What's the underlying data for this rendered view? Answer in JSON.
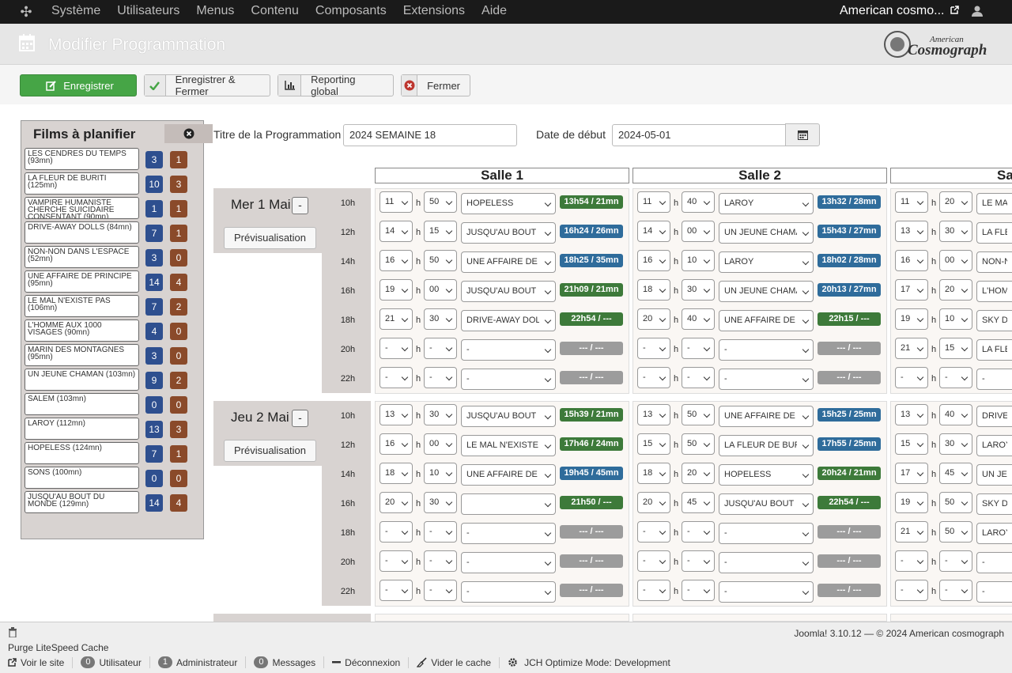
{
  "topnav": {
    "menu": [
      "Système",
      "Utilisateurs",
      "Menus",
      "Contenu",
      "Composants",
      "Extensions",
      "Aide"
    ],
    "site_name": "American cosmo..."
  },
  "header": {
    "title": "Modifier Programmation",
    "brand": "American Cosmograph"
  },
  "toolbar": {
    "save": "Enregistrer",
    "save_close": "Enregistrer & Fermer",
    "reporting": "Reporting global",
    "close": "Fermer"
  },
  "films_panel": {
    "title": "Films à planifier",
    "films": [
      {
        "name": "LES CENDRES DU TEMPS (93mn)",
        "n1": "3",
        "n2": "1"
      },
      {
        "name": "LA FLEUR DE BURITI (125mn)",
        "n1": "10",
        "n2": "3"
      },
      {
        "name": "VAMPIRE HUMANISTE CHERCHE SUICIDAIRE CONSENTANT (90mn)",
        "n1": "1",
        "n2": "1"
      },
      {
        "name": "DRIVE-AWAY DOLLS (84mn)",
        "n1": "7",
        "n2": "1"
      },
      {
        "name": "NON-NON DANS L'ESPACE (52mn)",
        "n1": "3",
        "n2": "0"
      },
      {
        "name": "UNE AFFAIRE DE PRINCIPE (95mn)",
        "n1": "14",
        "n2": "4"
      },
      {
        "name": "LE MAL N'EXISTE PAS (106mn)",
        "n1": "7",
        "n2": "2"
      },
      {
        "name": "L'HOMME AUX 1000 VISAGES (90mn)",
        "n1": "4",
        "n2": "0"
      },
      {
        "name": "MARIN DES MONTAGNES (95mn)",
        "n1": "3",
        "n2": "0"
      },
      {
        "name": "UN JEUNE CHAMAN (103mn)",
        "n1": "9",
        "n2": "2"
      },
      {
        "name": "SALEM (103mn)",
        "n1": "0",
        "n2": "0"
      },
      {
        "name": "LAROY (112mn)",
        "n1": "13",
        "n2": "3"
      },
      {
        "name": "HOPELESS (124mn)",
        "n1": "7",
        "n2": "1"
      },
      {
        "name": "SONS (100mn)",
        "n1": "0",
        "n2": "0"
      },
      {
        "name": "JUSQU'AU BOUT DU MONDE (129mn)",
        "n1": "14",
        "n2": "4"
      }
    ]
  },
  "form": {
    "title_label": "Titre de la Programmation",
    "title_value": "2024 SEMAINE 18",
    "start_label": "Date de début",
    "start_value": "2024-05-01"
  },
  "salles": [
    "Salle 1",
    "Salle 2",
    "Sa"
  ],
  "hour_labels": [
    "10h",
    "12h",
    "14h",
    "16h",
    "18h",
    "20h",
    "22h"
  ],
  "h_sep": "h",
  "preview_label": "Prévisualisation",
  "minus_label": "-",
  "days": [
    {
      "name": "Mer 1 Mai",
      "salles": [
        [
          {
            "hh": "11",
            "mm": "50",
            "film": "HOPELESS",
            "badge": "13h54 / 21mn",
            "color": "green"
          },
          {
            "hh": "14",
            "mm": "15",
            "film": "JUSQU'AU BOUT D",
            "badge": "16h24 / 26mn",
            "color": "blue"
          },
          {
            "hh": "16",
            "mm": "50",
            "film": "UNE AFFAIRE DE PI",
            "badge": "18h25 / 35mn",
            "color": "blue"
          },
          {
            "hh": "19",
            "mm": "00",
            "film": "JUSQU'AU BOUT D",
            "badge": "21h09 / 21mn",
            "color": "green"
          },
          {
            "hh": "21",
            "mm": "30",
            "film": "DRIVE-AWAY DOLL",
            "badge": "22h54 /  ---",
            "color": "green"
          },
          {
            "hh": "-",
            "mm": "-",
            "film": "-",
            "badge": "---   /  ---",
            "color": "gray"
          },
          {
            "hh": "-",
            "mm": "-",
            "film": "-",
            "badge": "---   /  ---",
            "color": "gray"
          }
        ],
        [
          {
            "hh": "11",
            "mm": "40",
            "film": "LAROY",
            "badge": "13h32 / 28mn",
            "color": "blue"
          },
          {
            "hh": "14",
            "mm": "00",
            "film": "UN JEUNE CHAMAI",
            "badge": "15h43 / 27mn",
            "color": "blue"
          },
          {
            "hh": "16",
            "mm": "10",
            "film": "LAROY",
            "badge": "18h02 / 28mn",
            "color": "blue"
          },
          {
            "hh": "18",
            "mm": "30",
            "film": "UN JEUNE CHAMAI",
            "badge": "20h13 / 27mn",
            "color": "blue"
          },
          {
            "hh": "20",
            "mm": "40",
            "film": "UNE AFFAIRE DE P",
            "badge": "22h15 /  ---",
            "color": "green"
          },
          {
            "hh": "-",
            "mm": "-",
            "film": "-",
            "badge": "---   /  ---",
            "color": "gray"
          },
          {
            "hh": "-",
            "mm": "-",
            "film": "-",
            "badge": "---   /  ---",
            "color": "gray"
          }
        ],
        [
          {
            "hh": "11",
            "mm": "20",
            "film": "LE MAL"
          },
          {
            "hh": "13",
            "mm": "30",
            "film": "LA FLEU"
          },
          {
            "hh": "16",
            "mm": "00",
            "film": "NON-NO"
          },
          {
            "hh": "17",
            "mm": "20",
            "film": "L'HOMM"
          },
          {
            "hh": "19",
            "mm": "10",
            "film": "SKY DO"
          },
          {
            "hh": "21",
            "mm": "15",
            "film": "LA FLEU"
          },
          {
            "hh": "-",
            "mm": "-",
            "film": "-"
          }
        ]
      ]
    },
    {
      "name": "Jeu 2 Mai",
      "salles": [
        [
          {
            "hh": "13",
            "mm": "30",
            "film": "JUSQU'AU BOUT D",
            "badge": "15h39 / 21mn",
            "color": "green"
          },
          {
            "hh": "16",
            "mm": "00",
            "film": "LE MAL N'EXISTE P",
            "badge": "17h46 / 24mn",
            "color": "green"
          },
          {
            "hh": "18",
            "mm": "10",
            "film": "UNE AFFAIRE DE PI",
            "badge": "19h45 / 45mn",
            "color": "blue"
          },
          {
            "hh": "20",
            "mm": "30",
            "film": "",
            "badge": "21h50 /  ---",
            "color": "green"
          },
          {
            "hh": "-",
            "mm": "-",
            "film": "-",
            "badge": "---   /  ---",
            "color": "gray"
          },
          {
            "hh": "-",
            "mm": "-",
            "film": "-",
            "badge": "---   /  ---",
            "color": "gray"
          },
          {
            "hh": "-",
            "mm": "-",
            "film": "-",
            "badge": "---   /  ---",
            "color": "gray"
          }
        ],
        [
          {
            "hh": "13",
            "mm": "50",
            "film": "UNE AFFAIRE DE PI",
            "badge": "15h25 / 25mn",
            "color": "blue"
          },
          {
            "hh": "15",
            "mm": "50",
            "film": "LA FLEUR DE BURI",
            "badge": "17h55 / 25mn",
            "color": "blue"
          },
          {
            "hh": "18",
            "mm": "20",
            "film": "HOPELESS",
            "badge": "20h24 / 21mn",
            "color": "green"
          },
          {
            "hh": "20",
            "mm": "45",
            "film": "JUSQU'AU BOUT D",
            "badge": "22h54 /  ---",
            "color": "green"
          },
          {
            "hh": "-",
            "mm": "-",
            "film": "-",
            "badge": "---   /  ---",
            "color": "gray"
          },
          {
            "hh": "-",
            "mm": "-",
            "film": "-",
            "badge": "---   /  ---",
            "color": "gray"
          },
          {
            "hh": "-",
            "mm": "-",
            "film": "-",
            "badge": "---   /  ---",
            "color": "gray"
          }
        ],
        [
          {
            "hh": "13",
            "mm": "40",
            "film": "DRIVE-A"
          },
          {
            "hh": "15",
            "mm": "30",
            "film": "LAROY"
          },
          {
            "hh": "17",
            "mm": "45",
            "film": "UN JEU"
          },
          {
            "hh": "19",
            "mm": "50",
            "film": "SKY DO"
          },
          {
            "hh": "21",
            "mm": "50",
            "film": "LAROY"
          },
          {
            "hh": "-",
            "mm": "-",
            "film": "-"
          },
          {
            "hh": "-",
            "mm": "-",
            "film": "-"
          }
        ]
      ]
    }
  ],
  "footer": {
    "purge": "Purge LiteSpeed Cache",
    "copyright": "Joomla! 3.10.12  —  © 2024 American cosmograph",
    "view_site": "Voir le site",
    "users_count": "0",
    "users_label": "Utilisateur",
    "admin_count": "1",
    "admin_label": "Administrateur",
    "msg_count": "0",
    "msg_label": "Messages",
    "logout": "Déconnexion",
    "clear_cache": "Vider le cache",
    "jch": "JCH Optimize Mode: Development"
  },
  "colors": {
    "green": "#3d7a3a",
    "blue": "#2f6c9b",
    "gray": "#9c9c9c",
    "panel": "#d8d3d1",
    "film_count": "#2e4f8f",
    "film_count2": "#8a4a2a"
  }
}
